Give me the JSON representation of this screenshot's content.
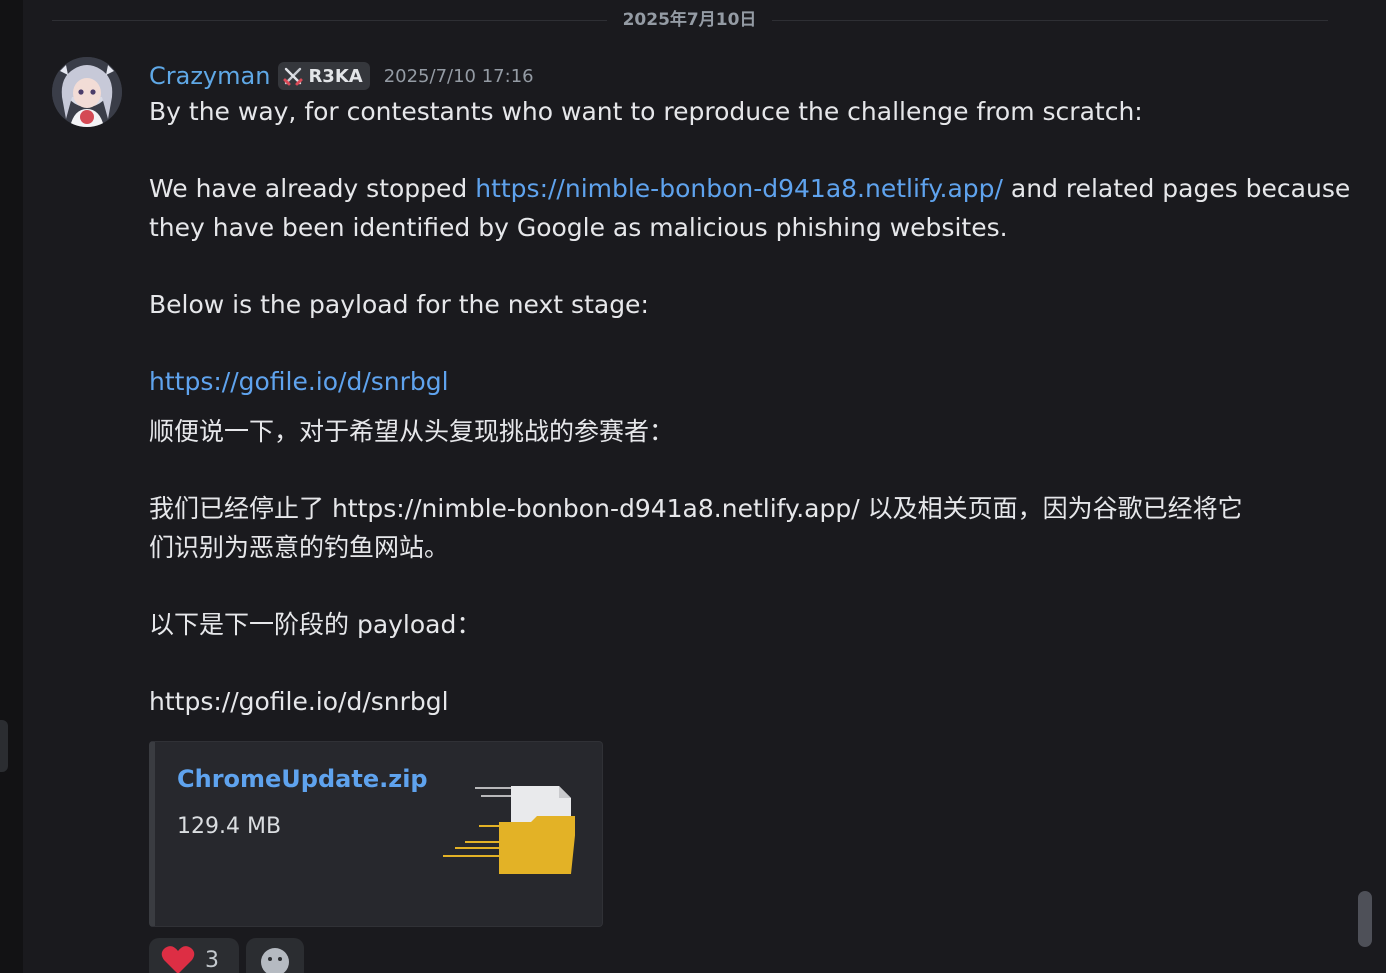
{
  "date_divider": "2025年7月10日",
  "message": {
    "author": "Crazyman",
    "tag": "R3KA",
    "tag_icon": "crossed-swords-icon",
    "timestamp": "2025/7/10 17:16",
    "lines": {
      "en1": "By the way, for contestants who want to reproduce the challenge from scratch:",
      "en2_pre": "We have already stopped ",
      "en2_link": "https://nimble-bonbon-d941a8.netlify.app/",
      "en2_post": " and related pages because",
      "en3": "they have been identified by Google as malicious phishing websites.",
      "en4": "Below is the payload for the next stage:",
      "en5_link": "https://gofile.io/d/snrbgl",
      "zh1": "顺便说一下，对于希望从头复现挑战的参赛者：",
      "zh2": "我们已经停止了 https://nimble-bonbon-d941a8.netlify.app/ 以及相关页面，因为谷歌已经将它",
      "zh3": "们识别为恶意的钓鱼网站。",
      "zh4": "以下是下一阶段的 payload：",
      "zh5": "https://gofile.io/d/snrbgl"
    }
  },
  "attachment": {
    "filename": "ChromeUpdate.zip",
    "size": "129.4 MB",
    "icon": "archive-file-icon"
  },
  "reactions": [
    {
      "emoji": "heart-icon",
      "count": "3"
    },
    {
      "emoji": "add-reaction-icon"
    }
  ],
  "colors": {
    "background": "#1a1a1e",
    "username": "#5fa8e6",
    "link": "#5fa3ee",
    "folder": "#e3b226"
  }
}
